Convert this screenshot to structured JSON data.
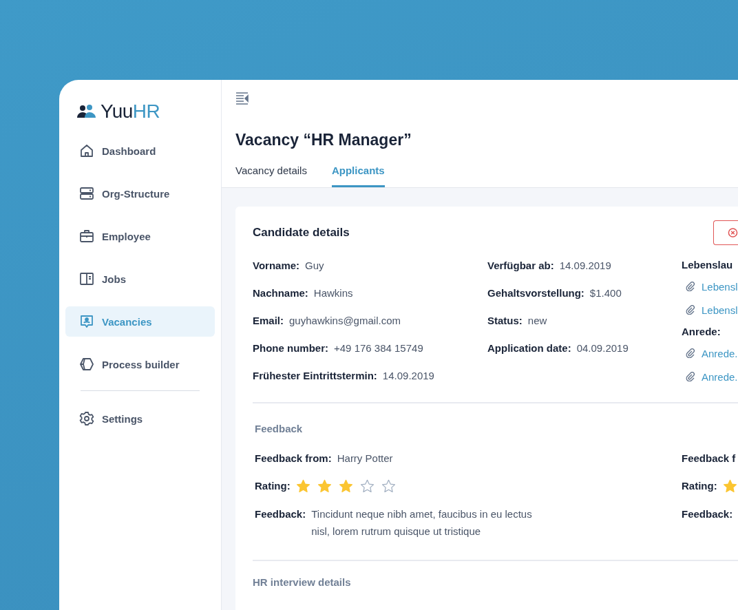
{
  "brand": {
    "name_dark": "Yuu",
    "name_accent": "HR"
  },
  "sidebar": {
    "items": [
      {
        "label": "Dashboard",
        "selected": false
      },
      {
        "label": "Org-Structure",
        "selected": false
      },
      {
        "label": "Employee",
        "selected": false
      },
      {
        "label": "Jobs",
        "selected": false
      },
      {
        "label": "Vacancies",
        "selected": true
      },
      {
        "label": "Process builder",
        "selected": false
      },
      {
        "label": "Settings",
        "selected": false
      }
    ]
  },
  "page": {
    "title": "Vacancy “HR Manager”",
    "tabs": [
      {
        "label": "Vacancy details",
        "selected": false
      },
      {
        "label": "Applicants",
        "selected": true
      }
    ]
  },
  "candidate": {
    "title": "Candidate details",
    "column_1": [
      {
        "label": "Vorname:",
        "value": "Guy"
      },
      {
        "label": "Nachname:",
        "value": "Hawkins"
      },
      {
        "label": "Email:",
        "value": "guyhawkins@gmail.com"
      },
      {
        "label": "Phone number:",
        "value": "+49 176 384 15749"
      },
      {
        "label": "Frühester Eintrittstermin:",
        "value": "14.09.2019"
      }
    ],
    "column_2": [
      {
        "label": "Verfügbar ab:",
        "value": "14.09.2019"
      },
      {
        "label": "Gehaltsvorstellung:",
        "value": "$1.400"
      },
      {
        "label": "Status:",
        "value": "new"
      },
      {
        "label": "Application date:",
        "value": "04.09.2019"
      }
    ],
    "attachments": [
      {
        "label": "Lebenslau",
        "files": [
          "Lebensl",
          "Lebensl"
        ]
      },
      {
        "label": "Anrede:",
        "files": [
          "Anrede.",
          "Anrede."
        ]
      }
    ]
  },
  "feedback": {
    "title": "Feedback",
    "entries": [
      {
        "from_label": "Feedback from:",
        "from": "Harry Potter",
        "rating_label": "Rating:",
        "stars": 3,
        "text_label": "Feedback:",
        "text": "Tincidunt neque nibh amet, faucibus in eu lectus nisl, lorem rutrum quisque ut tristique"
      },
      {
        "from_label": "Feedback f",
        "rating_label": "Rating:",
        "text_label": "Feedback:"
      }
    ]
  },
  "hr_interview": {
    "title": "HR interview details"
  }
}
